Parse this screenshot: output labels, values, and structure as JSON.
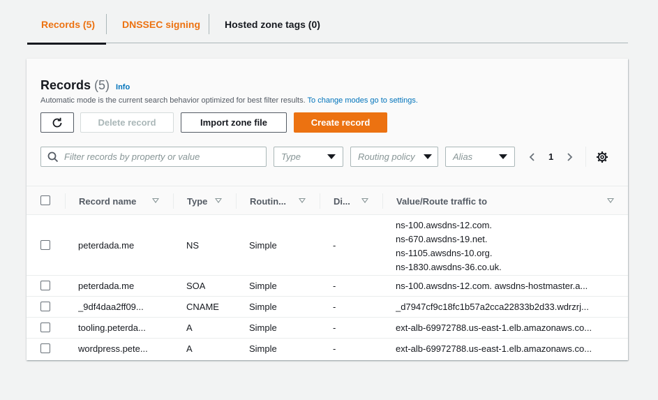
{
  "tabs": [
    {
      "label": "Records (5)"
    },
    {
      "label": "DNSSEC signing"
    },
    {
      "label": "Hosted zone tags (0)"
    }
  ],
  "header": {
    "title": "Records",
    "count": "(5)",
    "info": "Info",
    "description": "Automatic mode is the current search behavior optimized for best filter results.",
    "description_link": "To change modes go to settings."
  },
  "actions": {
    "refresh_icon": "refresh-icon",
    "delete": "Delete record",
    "import": "Import zone file",
    "create": "Create record"
  },
  "filters": {
    "search_placeholder": "Filter records by property or value",
    "type": "Type",
    "routing": "Routing policy",
    "alias": "Alias"
  },
  "pagination": {
    "page": "1"
  },
  "table": {
    "columns": [
      "Record name",
      "Type",
      "Routin...",
      "Di...",
      "Value/Route traffic to"
    ],
    "rows": [
      {
        "name": "peterdada.me",
        "type": "NS",
        "routing": "Simple",
        "diff": "-",
        "values": [
          "ns-100.awsdns-12.com.",
          "ns-670.awsdns-19.net.",
          "ns-1105.awsdns-10.org.",
          "ns-1830.awsdns-36.co.uk."
        ]
      },
      {
        "name": "peterdada.me",
        "type": "SOA",
        "routing": "Simple",
        "diff": "-",
        "values": [
          "ns-100.awsdns-12.com. awsdns-hostmaster.a..."
        ]
      },
      {
        "name": "_9df4daa2ff09...",
        "type": "CNAME",
        "routing": "Simple",
        "diff": "-",
        "values": [
          "_d7947cf9c18fc1b57a2cca22833b2d33.wdrzrj..."
        ]
      },
      {
        "name": "tooling.peterda...",
        "type": "A",
        "routing": "Simple",
        "diff": "-",
        "values": [
          "ext-alb-69972788.us-east-1.elb.amazonaws.co..."
        ]
      },
      {
        "name": "wordpress.pete...",
        "type": "A",
        "routing": "Simple",
        "diff": "-",
        "values": [
          "ext-alb-69972788.us-east-1.elb.amazonaws.co..."
        ]
      }
    ]
  }
}
